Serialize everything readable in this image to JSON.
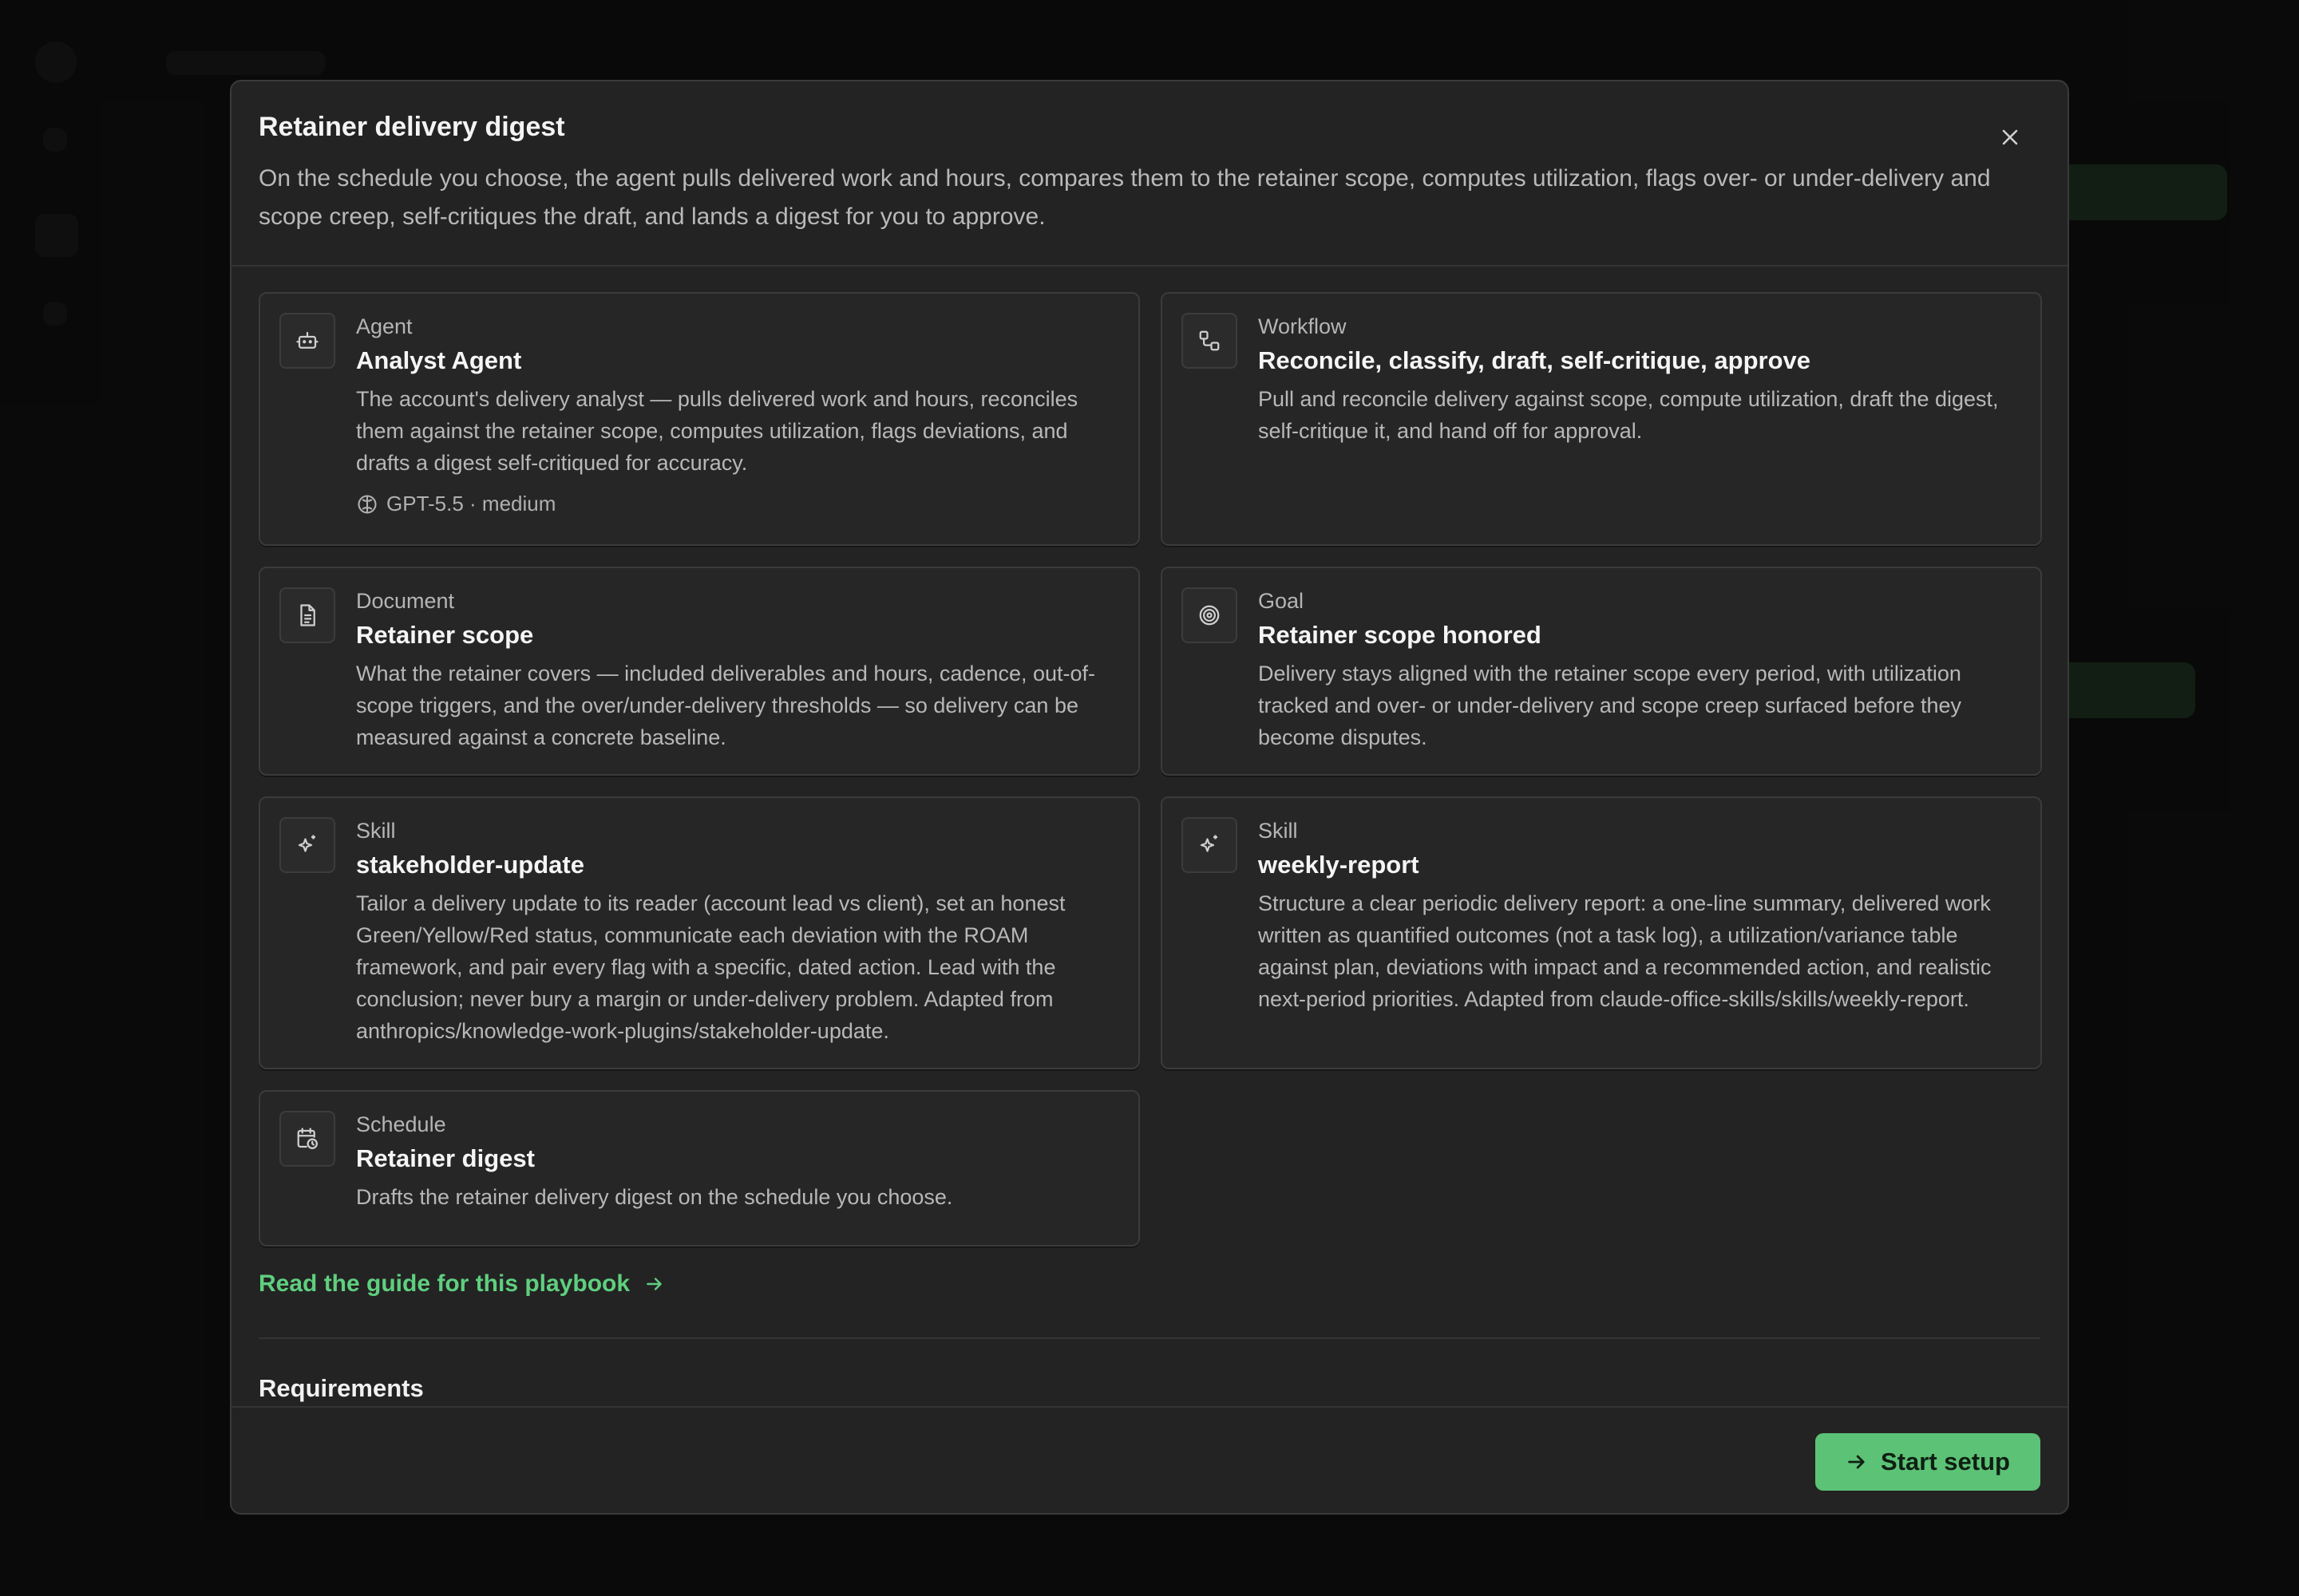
{
  "colors": {
    "accent": "#5fcf7f",
    "button_bg": "#5cc275",
    "modal_bg": "#232323",
    "card_bg": "#262626"
  },
  "modal": {
    "title": "Retainer delivery digest",
    "description": "On the schedule you choose, the agent pulls delivered work and hours, compares them to the retainer scope, computes utilization, flags over- or under-delivery and scope creep, self-critiques the draft, and lands a digest for you to approve.",
    "close_icon": "close-icon"
  },
  "cards": {
    "agent": {
      "kind": "Agent",
      "name": "Analyst Agent",
      "body": "The account's delivery analyst — pulls delivered work and hours, reconciles them against the retainer scope, computes utilization, flags deviations, and drafts a digest self-critiqued for accuracy.",
      "model": "GPT-5.5 · medium",
      "icon": "robot-icon"
    },
    "workflow": {
      "kind": "Workflow",
      "name": "Reconcile, classify, draft, self-critique, approve",
      "body": "Pull and reconcile delivery against scope, compute utilization, draft the digest, self-critique it, and hand off for approval.",
      "icon": "workflow-icon"
    },
    "document": {
      "kind": "Document",
      "name": "Retainer scope",
      "body": "What the retainer covers — included deliverables and hours, cadence, out-of-scope triggers, and the over/under-delivery thresholds — so delivery can be measured against a concrete baseline.",
      "icon": "document-icon"
    },
    "goal": {
      "kind": "Goal",
      "name": "Retainer scope honored",
      "body": "Delivery stays aligned with the retainer scope every period, with utilization tracked and over- or under-delivery and scope creep surfaced before they become disputes.",
      "icon": "target-icon"
    },
    "skill1": {
      "kind": "Skill",
      "name": "stakeholder-update",
      "body": "Tailor a delivery update to its reader (account lead vs client), set an honest Green/Yellow/Red status, communicate each deviation with the ROAM framework, and pair every flag with a specific, dated action. Lead with the conclusion; never bury a margin or under-delivery problem. Adapted from anthropics/knowledge-work-plugins/stakeholder-update.",
      "icon": "sparkle-icon"
    },
    "skill2": {
      "kind": "Skill",
      "name": "weekly-report",
      "body": "Structure a clear periodic delivery report: a one-line summary, delivered work written as quantified outcomes (not a task log), a utilization/variance table against plan, deviations with impact and a recommended action, and realistic next-period priorities. Adapted from claude-office-skills/skills/weekly-report.",
      "icon": "sparkle-icon"
    },
    "schedule": {
      "kind": "Schedule",
      "name": "Retainer digest",
      "body": "Drafts the retainer delivery digest on the schedule you choose.",
      "icon": "calendar-clock-icon"
    }
  },
  "guide_link": {
    "label": "Read the guide for this playbook",
    "icon": "arrow-right-icon"
  },
  "requirements": {
    "title": "Requirements"
  },
  "footer": {
    "start_label": "Start setup",
    "icon": "arrow-right-icon"
  }
}
